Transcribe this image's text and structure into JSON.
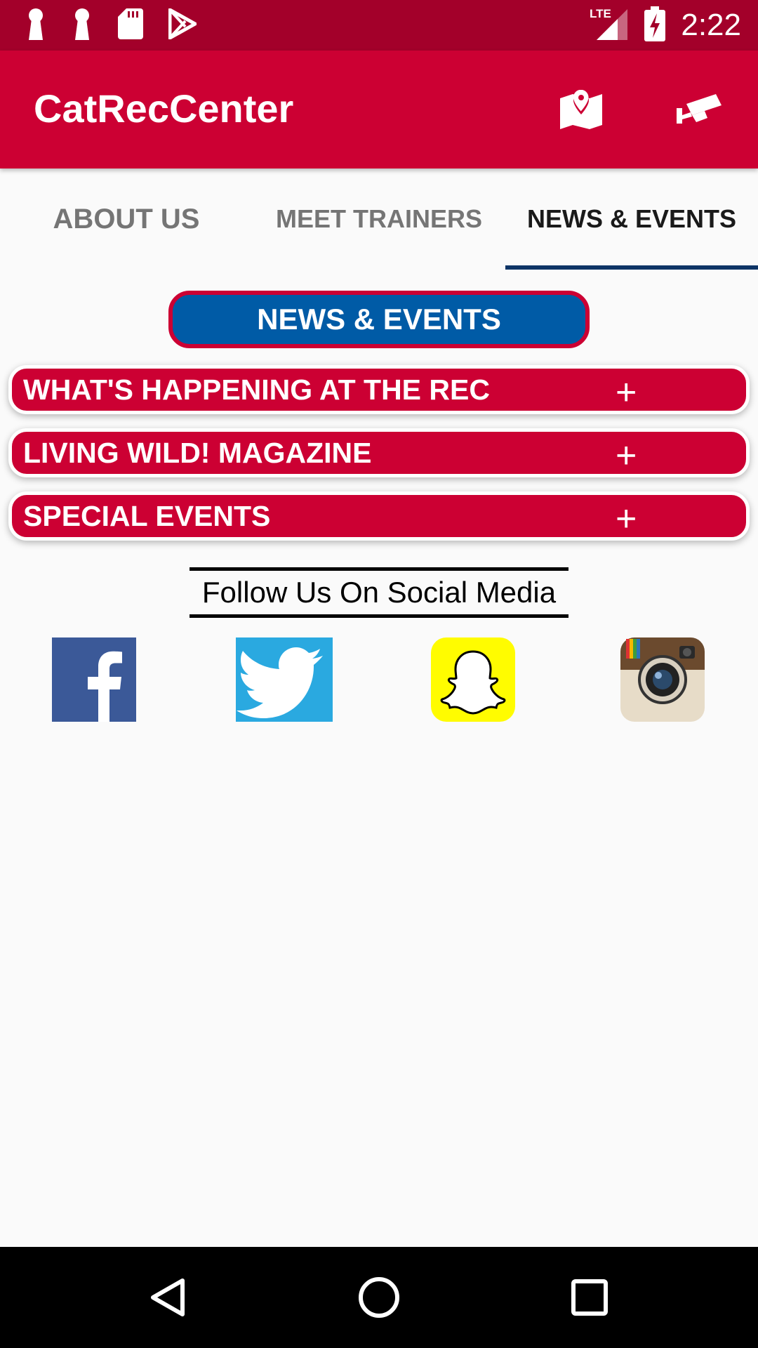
{
  "status_bar": {
    "time": "2:22",
    "network": "LTE"
  },
  "app_bar": {
    "title": "CatRecCenter",
    "map_icon": "map-pin-icon",
    "camera_icon": "security-camera-icon"
  },
  "tabs": [
    {
      "label": "ABOUT US",
      "active": false
    },
    {
      "label": "MEET TRAINERS",
      "active": false
    },
    {
      "label": "NEWS & EVENTS",
      "active": true
    }
  ],
  "section": {
    "title": "NEWS & EVENTS"
  },
  "accordion": [
    {
      "label": "WHAT'S HAPPENING AT THE REC",
      "toggle": "+"
    },
    {
      "label": "LIVING WILD! MAGAZINE",
      "toggle": "+"
    },
    {
      "label": "SPECIAL EVENTS",
      "toggle": "+"
    }
  ],
  "social": {
    "heading": "Follow Us On Social Media",
    "links": [
      "facebook-icon",
      "twitter-icon",
      "snapchat-icon",
      "instagram-icon"
    ]
  },
  "colors": {
    "status_bar": "#a3002a",
    "brand_red": "#cc0033",
    "brand_blue": "#005ba6",
    "tab_indicator": "#0d3466"
  }
}
